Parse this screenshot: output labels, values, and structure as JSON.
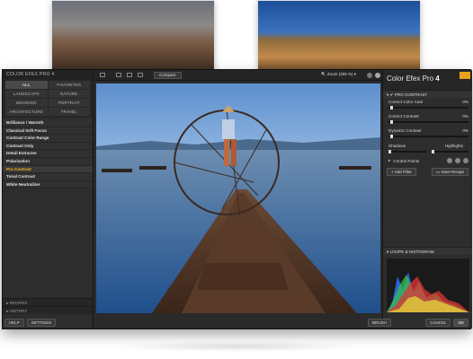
{
  "app": {
    "title": "COLOR EFEX PRO 4",
    "brand_name": "Color Efex Pro",
    "brand_version": "4"
  },
  "left_panel": {
    "categories": [
      "ALL",
      "FAVORITES",
      "LANDSCAPE",
      "NATURE",
      "WEDDING",
      "PORTRAIT",
      "ARCHITECTURE",
      "TRAVEL"
    ],
    "active_category": "ALL",
    "filters": [
      "Brilliance / Warmth",
      "Classical Soft Focus",
      "Contrast Color Range",
      "Contrast Only",
      "Detail Extractor",
      "Polarization",
      "Pro Contrast",
      "Tonal Contrast",
      "White Neutralizer"
    ],
    "highlighted_filter": "Pro Contrast",
    "recipes_label": "RECIPES",
    "history_label": "HISTORY",
    "help_label": "HELP",
    "settings_label": "SETTINGS"
  },
  "toolbar": {
    "compare_label": "Compare",
    "zoom_label": "Zoom (289 %)"
  },
  "right_panel": {
    "section_title": "PRO CONTRAST",
    "controls": [
      {
        "label": "Correct Color Cast",
        "value": "0%",
        "level": 0.02
      },
      {
        "label": "Correct Contrast",
        "value": "0%",
        "level": 0.02
      },
      {
        "label": "Dynamic Contrast",
        "value": "0%",
        "level": 0.02
      }
    ],
    "shadows_label": "Shadows",
    "highlights_label": "Highlights",
    "control_points_label": "Control Points",
    "add_filter_label": "Add Filter",
    "save_recipe_label": "Save Recipe",
    "histogram_title": "LOUPE & HISTOGRAM"
  },
  "footer": {
    "brush_label": "BRUSH",
    "cancel_label": "CANCEL",
    "ok_label": "OK"
  },
  "colors": {
    "highlight": "#f7b21b",
    "panel_bg": "#2d2d2d",
    "accent_logo": "#e8a21a"
  }
}
